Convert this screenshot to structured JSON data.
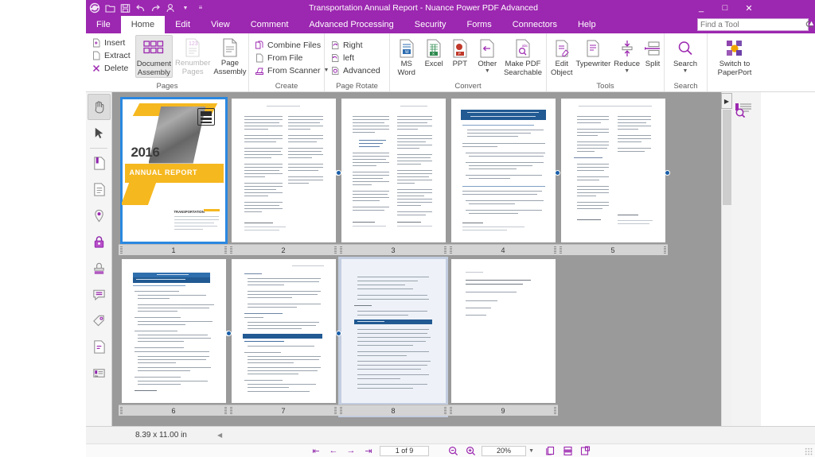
{
  "window": {
    "title": "Transportation Annual Report - Nuance Power PDF Advanced",
    "minimize": "_",
    "maximize": "□",
    "close": "✕",
    "accent_color": "#9c27b0"
  },
  "quick_access": [
    {
      "name": "app-logo-icon",
      "label": "Power PDF"
    },
    {
      "name": "open-icon",
      "label": "Open"
    },
    {
      "name": "save-icon",
      "label": "Save"
    },
    {
      "name": "undo-icon",
      "label": "Undo"
    },
    {
      "name": "redo-icon",
      "label": "Redo"
    },
    {
      "name": "signature-icon",
      "label": "Sign"
    },
    {
      "name": "qat-dropdown-icon",
      "label": "Customize Quick Access Toolbar"
    }
  ],
  "menu": {
    "tabs": [
      {
        "label": "File",
        "active": false
      },
      {
        "label": "Home",
        "active": true
      },
      {
        "label": "Edit",
        "active": false
      },
      {
        "label": "View",
        "active": false
      },
      {
        "label": "Comment",
        "active": false
      },
      {
        "label": "Advanced Processing",
        "active": false
      },
      {
        "label": "Security",
        "active": false
      },
      {
        "label": "Forms",
        "active": false
      },
      {
        "label": "Connectors",
        "active": false
      },
      {
        "label": "Help",
        "active": false
      }
    ],
    "find_tool_placeholder": "Find a Tool",
    "find_tool_value": ""
  },
  "ribbon": {
    "groups": [
      {
        "title": "Pages",
        "small_items": [
          {
            "label": "Insert",
            "icon": "insert-page-icon"
          },
          {
            "label": "Extract",
            "icon": "extract-page-icon"
          },
          {
            "label": "Delete",
            "icon": "delete-page-icon"
          }
        ],
        "big_items": [
          {
            "label_line1": "Document",
            "label_line2": "Assembly",
            "icon": "document-assembly-icon",
            "state": "active"
          },
          {
            "label_line1": "Renumber",
            "label_line2": "Pages",
            "icon": "renumber-pages-icon",
            "state": "disabled"
          },
          {
            "label_line1": "Page",
            "label_line2": "Assembly",
            "icon": "page-assembly-icon",
            "state": "normal"
          }
        ]
      },
      {
        "title": "Create",
        "small_items": [
          {
            "label": "Combine Files",
            "icon": "combine-files-icon"
          },
          {
            "label": "From File",
            "icon": "from-file-icon"
          },
          {
            "label": "From Scanner",
            "icon": "from-scanner-icon",
            "caret": true
          }
        ],
        "big_items": []
      },
      {
        "title": "Page Rotate",
        "small_items": [
          {
            "label": "Right",
            "icon": "rotate-right-icon"
          },
          {
            "label": "left",
            "icon": "rotate-left-icon"
          },
          {
            "label": "Advanced",
            "icon": "rotate-advanced-icon"
          }
        ],
        "big_items": []
      },
      {
        "title": "Convert",
        "small_items": [],
        "big_items": [
          {
            "label_line1": "MS",
            "label_line2": "Word",
            "icon": "ms-word-icon",
            "state": "normal"
          },
          {
            "label_line1": "Excel",
            "label_line2": "",
            "icon": "excel-icon",
            "state": "normal"
          },
          {
            "label_line1": "PPT",
            "label_line2": "",
            "icon": "powerpoint-icon",
            "state": "normal"
          },
          {
            "label_line1": "Other",
            "label_line2": "",
            "icon": "other-convert-icon",
            "state": "normal",
            "caret": true
          },
          {
            "label_line1": "Make PDF",
            "label_line2": "Searchable",
            "icon": "make-pdf-searchable-icon",
            "state": "normal",
            "caret_inline": true
          }
        ]
      },
      {
        "title": "Tools",
        "small_items": [],
        "big_items": [
          {
            "label_line1": "Edit",
            "label_line2": "Object",
            "icon": "edit-object-icon",
            "state": "normal"
          },
          {
            "label_line1": "Typewriter",
            "label_line2": "",
            "icon": "typewriter-icon",
            "state": "normal"
          },
          {
            "label_line1": "Reduce",
            "label_line2": "",
            "icon": "reduce-icon",
            "state": "normal",
            "caret": true
          },
          {
            "label_line1": "Split",
            "label_line2": "",
            "icon": "split-icon",
            "state": "normal"
          }
        ]
      },
      {
        "title": "Search",
        "small_items": [],
        "big_items": [
          {
            "label_line1": "Search",
            "label_line2": "",
            "icon": "search-icon",
            "state": "normal",
            "caret": true
          }
        ]
      },
      {
        "title": "",
        "small_items": [],
        "big_items": [
          {
            "label_line1": "Switch to",
            "label_line2": "PaperPort",
            "icon": "paperport-icon",
            "state": "normal"
          }
        ]
      }
    ]
  },
  "toolrail": [
    {
      "name": "hand-tool-icon",
      "label": "Hand Tool",
      "active": true
    },
    {
      "name": "select-tool-icon",
      "label": "Select Tool",
      "active": false
    },
    {
      "name": "bookmarks-icon",
      "label": "Bookmarks",
      "active": false
    },
    {
      "name": "pages-panel-icon",
      "label": "Pages",
      "active": false
    },
    {
      "name": "destinations-icon",
      "label": "Destinations",
      "active": false
    },
    {
      "name": "security-lock-icon",
      "label": "Security",
      "active": false
    },
    {
      "name": "stamp-icon",
      "label": "Stamps",
      "active": false
    },
    {
      "name": "comments-icon",
      "label": "Comments",
      "active": false
    },
    {
      "name": "attachments-icon",
      "label": "Attachments",
      "active": false
    },
    {
      "name": "document-panel-icon",
      "label": "Document",
      "active": false
    },
    {
      "name": "signature-panel-icon",
      "label": "Signatures",
      "active": false
    }
  ],
  "thumbnails": {
    "pages": [
      {
        "number": "1",
        "kind": "cover",
        "selected": true,
        "hovered": false,
        "handles": false
      },
      {
        "number": "2",
        "kind": "two-col",
        "selected": false,
        "hovered": false,
        "handles": true
      },
      {
        "number": "3",
        "kind": "two-col",
        "selected": false,
        "hovered": false,
        "handles": true
      },
      {
        "number": "4",
        "kind": "blue-head",
        "selected": false,
        "hovered": false,
        "handles": true
      },
      {
        "number": "5",
        "kind": "two-col",
        "selected": false,
        "hovered": false,
        "handles": true
      },
      {
        "number": "6",
        "kind": "blue-head-2",
        "selected": false,
        "hovered": false,
        "handles": true
      },
      {
        "number": "7",
        "kind": "blue-mid",
        "selected": false,
        "hovered": false,
        "handles": true
      },
      {
        "number": "8",
        "kind": "blue-mid-2",
        "selected": false,
        "hovered": true,
        "handles": true
      },
      {
        "number": "9",
        "kind": "sparse",
        "selected": false,
        "hovered": false,
        "handles": false
      }
    ],
    "cover": {
      "year": "2016",
      "subtitle": "ANNUAL REPORT",
      "caption_heading": "TRANSPORTATION"
    }
  },
  "right_panel": {
    "expand_label": "▶",
    "search_panel_icon": "search-panel-icon"
  },
  "size_bar": {
    "page_size": "8.39 x 11.00 in"
  },
  "status_bar": {
    "first_page_label": "⇤",
    "prev_page_label": "←",
    "next_page_label": "→",
    "last_page_label": "⇥",
    "page_indicator": "1 of 9",
    "zoom_out_label": "zoom-out-icon",
    "zoom_in_label": "zoom-in-icon",
    "zoom_level": "20%",
    "view_single_icon": "single-page-view-icon",
    "view_continuous_icon": "continuous-view-icon",
    "view_facing_icon": "facing-page-view-icon"
  }
}
